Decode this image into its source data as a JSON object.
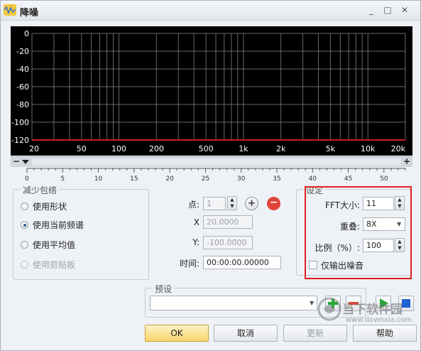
{
  "window": {
    "title": "降噪",
    "controls": {
      "minimize": "_",
      "maximize": "□",
      "close": "✕"
    }
  },
  "chart_data": {
    "type": "line",
    "y_ticks": [
      "0",
      "-20",
      "-40",
      "-60",
      "-80",
      "-100",
      "-120"
    ],
    "ylim": [
      -120,
      0
    ],
    "x_ticks": [
      "20",
      "50",
      "100",
      "200",
      "500",
      "1k",
      "2k",
      "5k",
      "10k",
      "20k"
    ],
    "x_values_hz": [
      20,
      50,
      100,
      200,
      500,
      1000,
      2000,
      5000,
      10000,
      20000
    ],
    "xlim": [
      20,
      20000
    ],
    "x_scale": "log",
    "grid": true,
    "background": "#000000",
    "grid_color": "#8a8a8a",
    "series": [
      {
        "x": [
          20,
          20000
        ],
        "y": [
          -120,
          -120
        ],
        "color": "#d02020"
      }
    ]
  },
  "scrollbar": {
    "left_label": "−",
    "right_label": "+"
  },
  "ruler": {
    "labels": [
      "0",
      "5",
      "10",
      "15",
      "20",
      "25",
      "30",
      "35",
      "40",
      "45",
      "50"
    ],
    "max": 53
  },
  "envelope": {
    "title": "减少包络",
    "options": [
      {
        "label": "使用形状",
        "checked": false,
        "disabled": false
      },
      {
        "label": "使用当前频谱",
        "checked": true,
        "disabled": false
      },
      {
        "label": "使用平均值",
        "checked": false,
        "disabled": false
      },
      {
        "label": "使用剪贴板",
        "checked": false,
        "disabled": true
      }
    ]
  },
  "point": {
    "point_label": "点:",
    "point_value": "1",
    "x_label": "X",
    "x_value": "20.0000",
    "y_label": "Y:",
    "y_value": "-100.0000",
    "time_label": "时间:",
    "time_value": "00:00:00.00000",
    "add_icon": "plus-circle-icon",
    "remove_icon": "minus-circle-icon"
  },
  "settings": {
    "title": "设定",
    "fft_label": "FFT大小:",
    "fft_value": "11",
    "overlap_label": "重叠:",
    "overlap_value": "8X",
    "ratio_label": "比例（%）:",
    "ratio_value": "100",
    "noise_only_label": "仅输出噪音",
    "noise_only_checked": false
  },
  "preset": {
    "title": "预设",
    "value": ""
  },
  "buttons": {
    "ok": "OK",
    "cancel": "取消",
    "update": "更新",
    "help": "帮助"
  },
  "colors": {
    "accent_red": "#e02020",
    "play_green": "#22aa33",
    "stop_blue": "#1f5fd1",
    "ok_yellow": "#f7d36a"
  },
  "watermark": {
    "line1": "当下软件园",
    "line2": "www.downxia.com"
  }
}
